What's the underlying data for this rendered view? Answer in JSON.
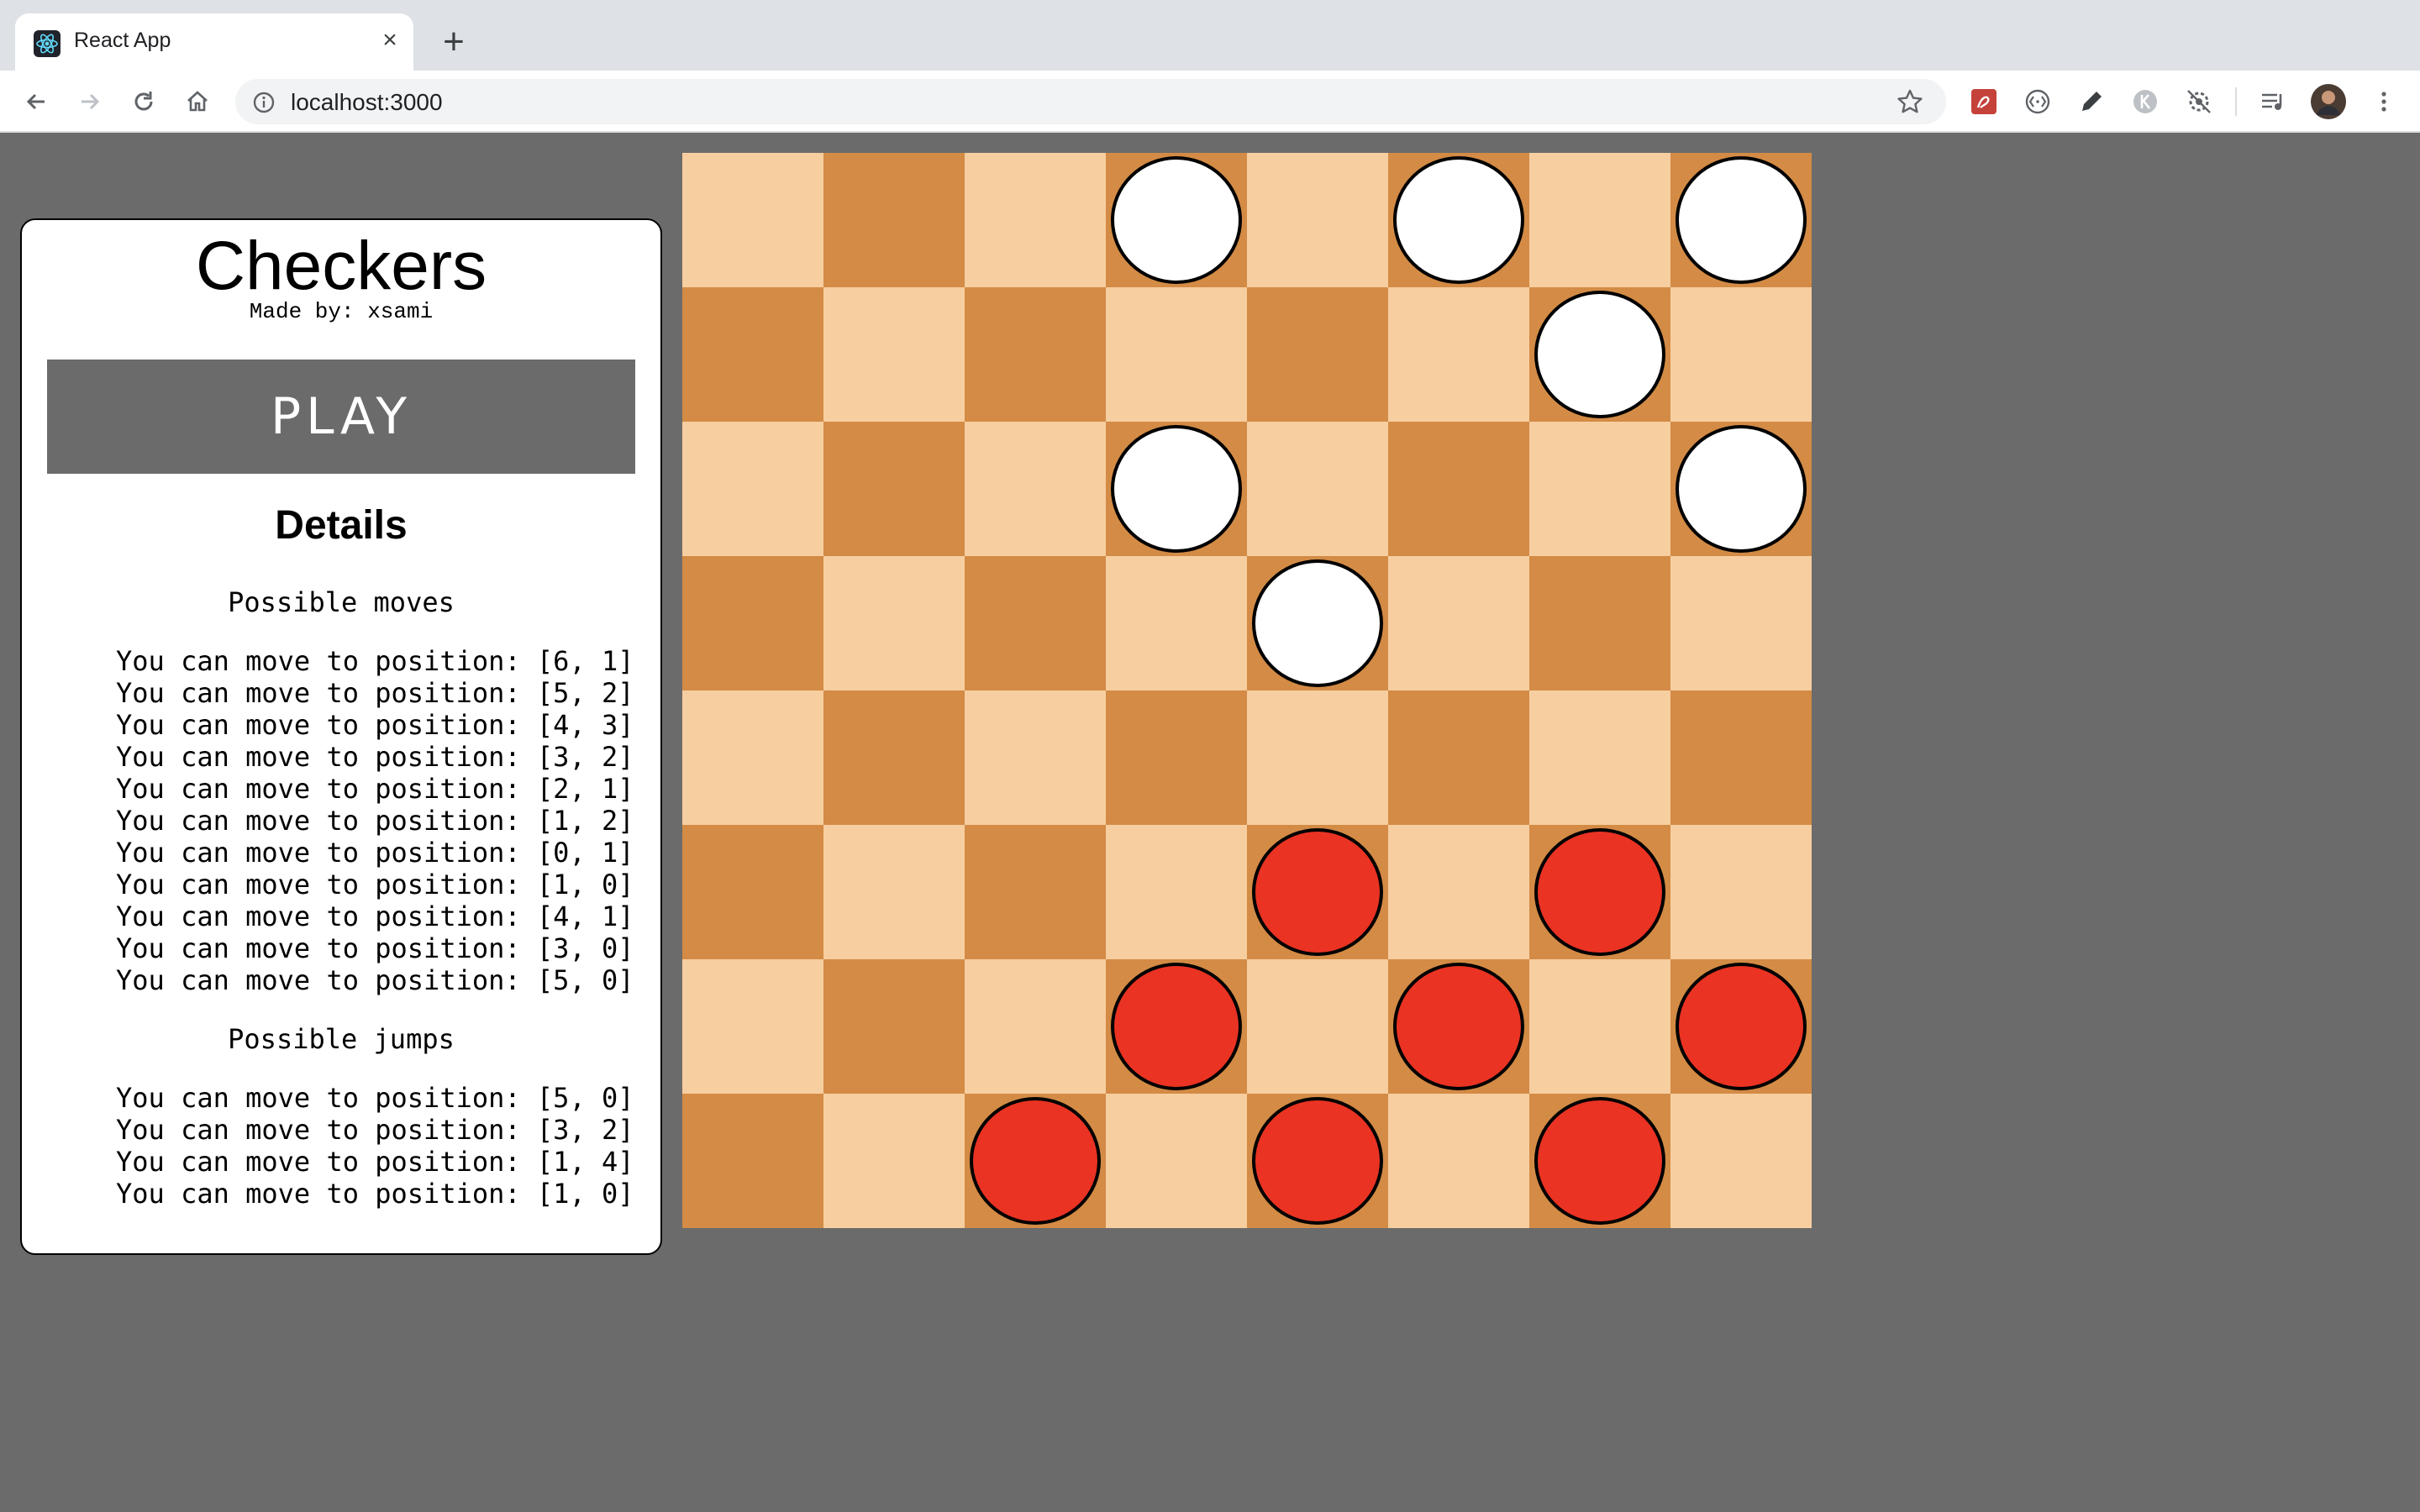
{
  "browser": {
    "tab_title": "React App",
    "tab_close": "×",
    "new_tab": "+",
    "url": "localhost:3000"
  },
  "panel": {
    "title": "Checkers",
    "author": "Made by: xsami",
    "play_label": "PLAY",
    "details_heading": "Details",
    "moves_heading": "Possible moves",
    "moves": [
      "You can move to position: [6, 1]",
      "You can move to position: [5, 2]",
      "You can move to position: [4, 3]",
      "You can move to position: [3, 2]",
      "You can move to position: [2, 1]",
      "You can move to position: [1, 2]",
      "You can move to position: [0, 1]",
      "You can move to position: [1, 0]",
      "You can move to position: [4, 1]",
      "You can move to position: [3, 0]",
      "You can move to position: [5, 0]"
    ],
    "jumps_heading": "Possible jumps",
    "jumps": [
      "You can move to position: [5, 0]",
      "You can move to position: [3, 2]",
      "You can move to position: [1, 4]",
      "You can move to position: [1, 0]"
    ]
  },
  "board": {
    "light_color": "#f7cea0",
    "dark_color": "#d38b45",
    "piece_colors": {
      "W": "#ffffff",
      "R": "#ea3323"
    },
    "rows": [
      [
        "",
        "",
        "",
        "W",
        "",
        "W",
        "",
        "W"
      ],
      [
        "",
        "",
        "",
        "",
        "",
        "",
        "W",
        ""
      ],
      [
        "",
        "",
        "",
        "W",
        "",
        "",
        "",
        "W"
      ],
      [
        "",
        "",
        "",
        "",
        "W",
        "",
        "",
        ""
      ],
      [
        "",
        "",
        "",
        "",
        "",
        "",
        "",
        ""
      ],
      [
        "",
        "",
        "",
        "",
        "R",
        "",
        "R",
        ""
      ],
      [
        "",
        "",
        "",
        "R",
        "",
        "R",
        "",
        "R"
      ],
      [
        "",
        "",
        "R",
        "",
        "R",
        "",
        "R",
        ""
      ]
    ]
  }
}
